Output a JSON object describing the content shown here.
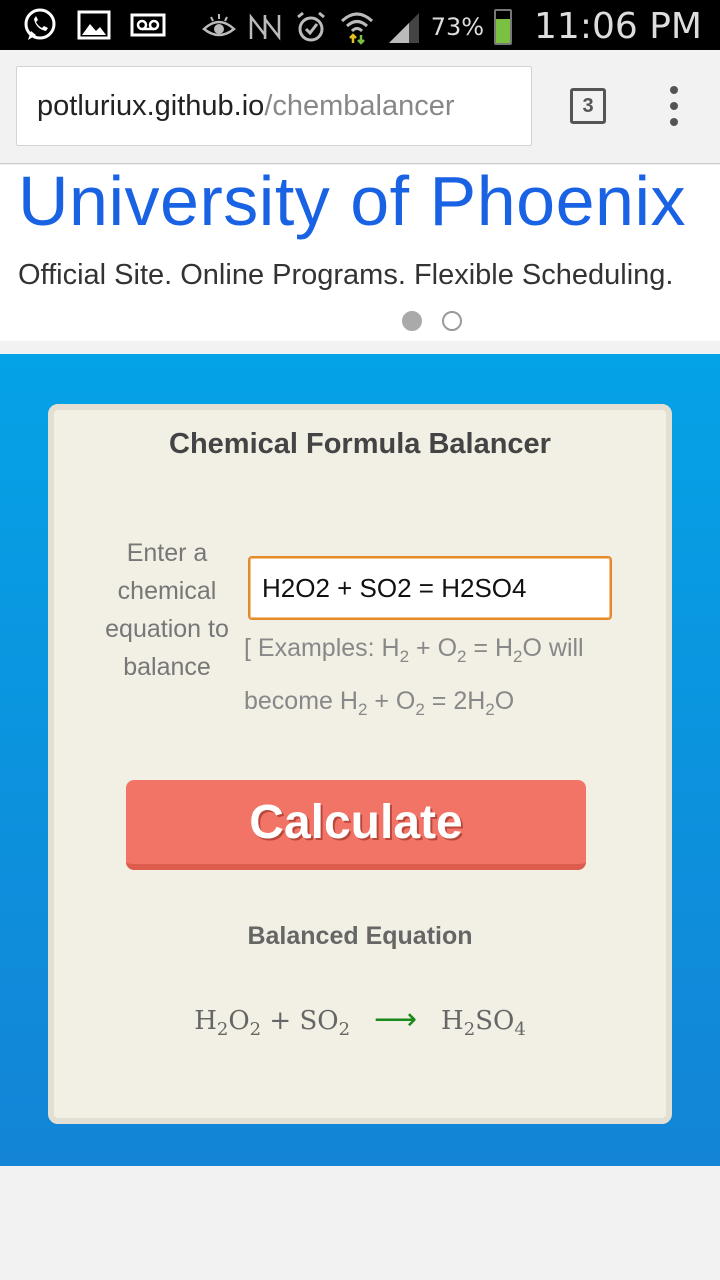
{
  "status_bar": {
    "icons_left": [
      "whatsapp-icon",
      "gallery-icon",
      "voicemail-icon"
    ],
    "icons_right": [
      "eye-icon",
      "nfc-icon",
      "alarm-icon",
      "wifi-icon",
      "signal-icon"
    ],
    "battery_percent": "73%",
    "battery_level": 0.73,
    "time": "11:06 PM"
  },
  "browser": {
    "url_host": "potluriux.github.io",
    "url_path": "/chembalancer",
    "tab_count": "3"
  },
  "ad": {
    "title": "University of Phoenix",
    "subtitle": "Official Site. Online Programs. Flexible Scheduling.",
    "active_page": 1,
    "page_count": 2
  },
  "app": {
    "title": "Chemical Formula Balancer",
    "input_label": "Enter a chemical equation to balance",
    "input_value": "H2O2 + SO2 = H2SO4",
    "examples_prefix": "[ Examples: H",
    "calculate_label": "Calculate",
    "result_title": "Balanced Equation"
  },
  "colors": {
    "accent_blue": "#04a2e6",
    "button": "#f27466",
    "card": "#f2efe4",
    "ad_title": "#1a62e4",
    "arrow": "#1a8a1a"
  }
}
